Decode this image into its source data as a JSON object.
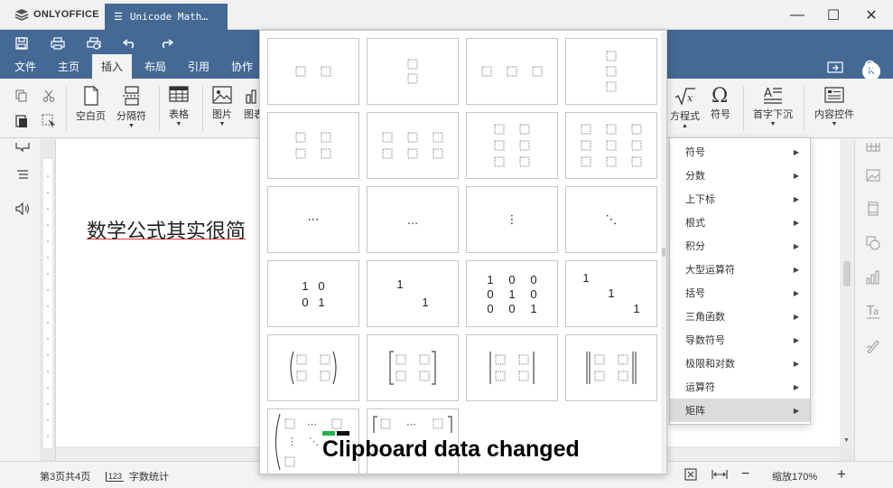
{
  "app": {
    "logo_text": "ONLYOFFICE",
    "doc_tab": "Unicode Math…"
  },
  "menu": {
    "tabs": [
      "文件",
      "主页",
      "插入",
      "布局",
      "引用",
      "协作"
    ],
    "active": "插入"
  },
  "user": {
    "avatar_initial": "K"
  },
  "toolbar": {
    "blank_page": "空白页",
    "page_break": "分隔符",
    "table": "表格",
    "image": "图片",
    "chart": "图表",
    "equation": "方程式",
    "symbol": "符号",
    "drop_cap": "首字下沉",
    "content_control": "内容控件"
  },
  "document": {
    "text": "数学公式其实很简"
  },
  "matrix_panel": {
    "dot_cells": [
      "⋯",
      "…",
      "⋮",
      "⋱"
    ],
    "identity_2x2": [
      [
        "1",
        "0"
      ],
      [
        "0",
        "1"
      ]
    ],
    "identity_2x2_sparse": [
      [
        "1",
        ""
      ],
      [
        "",
        "1"
      ]
    ],
    "identity_3x3": [
      [
        "1",
        "0",
        "0"
      ],
      [
        "0",
        "1",
        "0"
      ],
      [
        "0",
        "0",
        "1"
      ]
    ],
    "identity_3x3_sparse": [
      [
        "1",
        "",
        ""
      ],
      [
        "",
        "1",
        ""
      ],
      [
        "",
        "",
        "1"
      ]
    ]
  },
  "submenu": {
    "items": [
      "符号",
      "分数",
      "上下标",
      "根式",
      "积分",
      "大型运算符",
      "括号",
      "三角函数",
      "导数符号",
      "极限和对数",
      "运算符",
      "矩阵"
    ],
    "active": "矩阵"
  },
  "status": {
    "page": "第3页共4页",
    "word_count": "字数统计",
    "zoom": "缩放170%"
  },
  "overlay": {
    "clipboard_message": "Clipboard data changed",
    "colors": [
      "#22b34a",
      "#111111"
    ]
  }
}
